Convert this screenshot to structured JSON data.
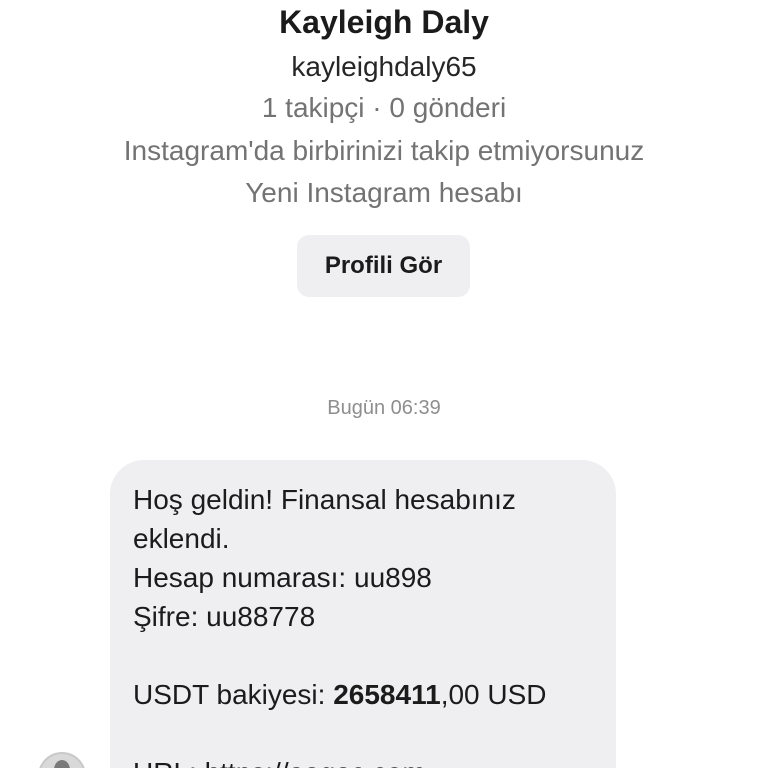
{
  "profile": {
    "name": "Kayleigh Daly",
    "username": "kayleighdaly65",
    "stats": "1 takipçi · 0 gönderi",
    "mutual_status": "Instagram'da birbirinizi takip etmiyorsunuz",
    "account_note": "Yeni Instagram hesabı",
    "view_profile_label": "Profili Gör"
  },
  "conversation": {
    "timestamp": "Bugün 06:39",
    "message": {
      "line1": "Hoş geldin! Finansal hesabınız",
      "line2": "eklendi.",
      "line3": "Hesap numarası: uu898",
      "line4": "Şifre: uu88778",
      "balance_label": "USDT bakiyesi: ",
      "balance_amount": "2658411",
      "balance_suffix": ",00 USD",
      "url_line": "URL: https://aagac.com"
    }
  }
}
